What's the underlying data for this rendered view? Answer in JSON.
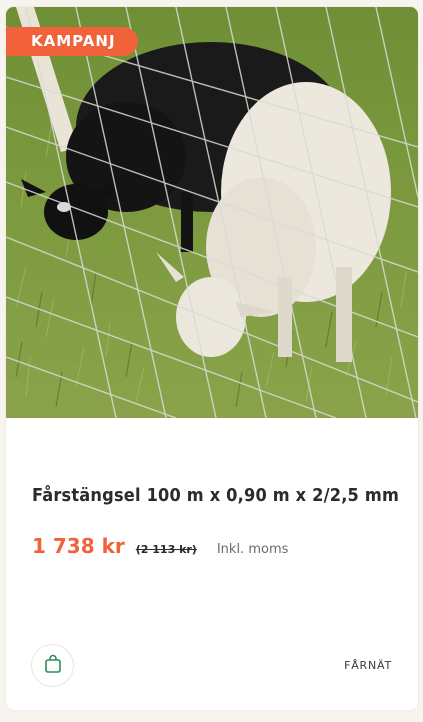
{
  "product": {
    "badge": "KAMPANJ",
    "image_alt": "Sheep grazing behind wire fence",
    "title": "Fårstängsel 100 m x 0,90 m x 2/2,5 mm",
    "price": "1 738 kr",
    "old_price": "(2 113 kr)",
    "vat_note": "Inkl. moms",
    "brand": "FÅRNÄT",
    "cart_icon": "shopping-bag-icon"
  },
  "colors": {
    "accent": "#f2623a",
    "cart_icon": "#2e8b57"
  }
}
